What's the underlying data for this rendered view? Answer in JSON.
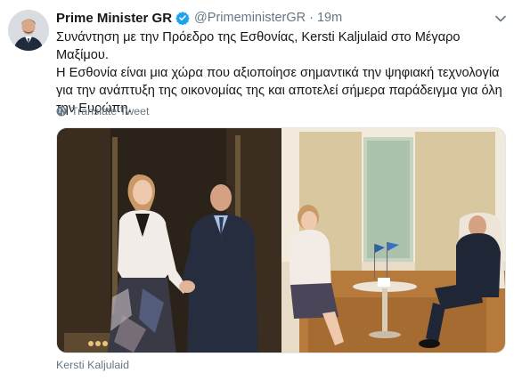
{
  "author": {
    "name": "Prime Minister GR",
    "handle": "@PrimeministerGR",
    "separator": "·",
    "timestamp": "19m",
    "verified": true
  },
  "tweet": {
    "line1": "Συνάντηση με την Πρόεδρο της Εσθονίας, Kersti Kaljulaid στο Μέγαρο Μαξίμου.",
    "line2": "Η Εσθονία είναι μια χώρα που αξιοποίησε σημαντικά την ψηφιακή τεχνολογία για την ανάπτυξη της οικονομίας της και αποτελεί σήμερα παράδειγμα για όλη την Ευρώπη."
  },
  "translate_label": "Translate Tweet",
  "media_caption": "Kersti Kaljulaid",
  "icons": {
    "verified": "verified-badge-icon",
    "caret": "chevron-down-icon",
    "translate": "globe-icon"
  },
  "colors": {
    "accent": "#1da1f2",
    "secondary_text": "#657786",
    "primary_text": "#14171a"
  }
}
